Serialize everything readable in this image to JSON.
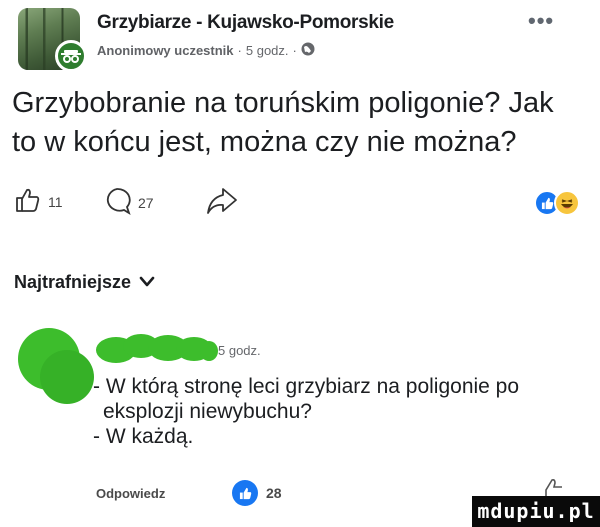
{
  "post": {
    "group_name": "Grzybiarze - Kujawsko-Pomorskie",
    "author": "Anonimowy uczestnik",
    "separator": "·",
    "time": "5 godz.",
    "more_label": "•••",
    "text_line1": "Grzybobranie na toruńskim poligonie? Jak",
    "text_line2": "to w końcu jest, można czy nie można?"
  },
  "actions": {
    "like_count": "11",
    "comment_count": "27",
    "reactions": [
      "like",
      "haha"
    ]
  },
  "comments": {
    "sort_label": "Najtrafniejsze",
    "items": [
      {
        "time": "5 godz.",
        "line1": "- W którą stronę leci grzybiarz na poligonie po",
        "line2": "eksplozji niewybuchu?",
        "line3": "- W każdą.",
        "reply_label": "Odpowiedz",
        "like_count": "28"
      }
    ]
  },
  "watermark": "mdupiu.pl",
  "colors": {
    "like_blue": "#1877f2",
    "anon_green": "#2f7d2f",
    "comment_avatar_green": "#3dbd2c",
    "meta_gray": "#65676b"
  }
}
